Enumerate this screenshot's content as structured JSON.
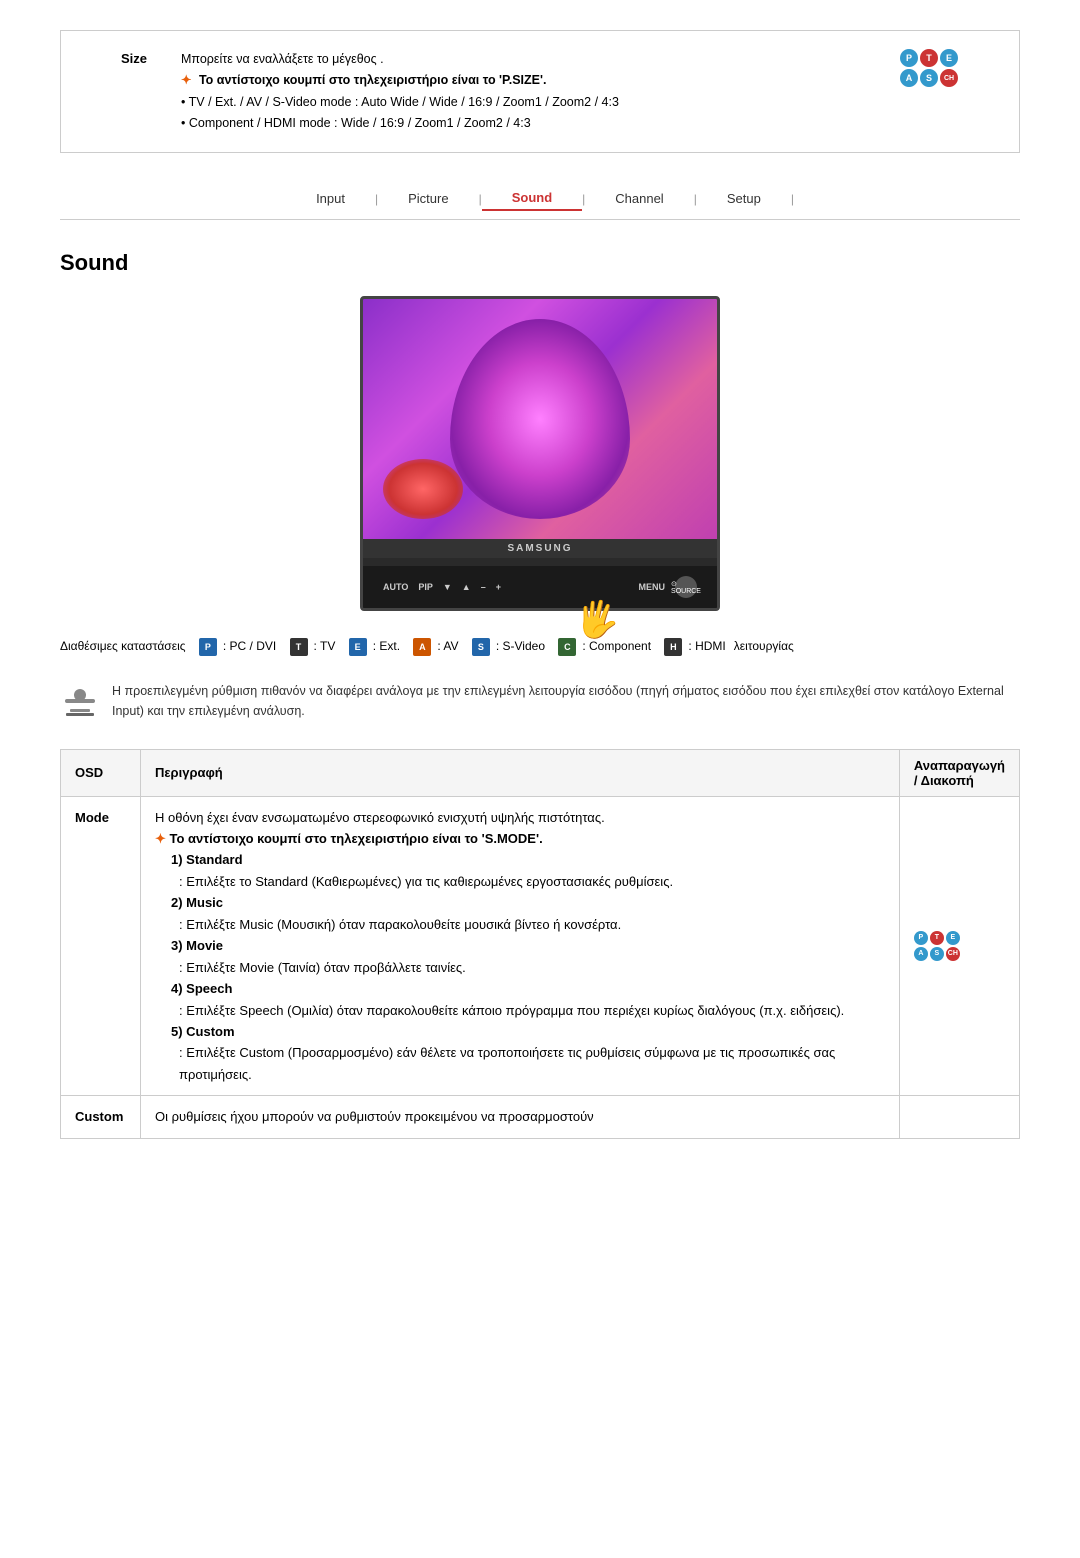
{
  "top": {
    "size_label": "Size",
    "size_text1": "Μπορείτε να εναλλάξετε το μέγεθος .",
    "size_text2": "Το αντίστοιχο κουμπί στο τηλεχειριστήριο είναι το 'P.SIZE'.",
    "size_text3": "TV / Ext. / AV / S-Video mode : Auto Wide / Wide / 16:9 / Zoom1 / Zoom2 / 4:3",
    "size_text4": "Component / HDMI mode : Wide / 16:9 / Zoom1 / Zoom2 / 4:3"
  },
  "nav": {
    "items": [
      {
        "label": "Input",
        "active": false
      },
      {
        "label": "Picture",
        "active": false
      },
      {
        "label": "Sound",
        "active": true
      },
      {
        "label": "Channel",
        "active": false
      },
      {
        "label": "Setup",
        "active": false
      }
    ]
  },
  "page": {
    "title": "Sound"
  },
  "tv": {
    "brand": "SAMSUNG",
    "buttons": [
      "AUTO",
      "PIP",
      "▼",
      "▲",
      "–",
      "+",
      "MENU",
      "SOURCE"
    ]
  },
  "modes_legend": {
    "label": "Διαθέσιμες καταστάσεις",
    "label2": "λειτουργίας",
    "modes": [
      {
        "letter": "P",
        "desc": "PC / DVI",
        "color": "blue"
      },
      {
        "letter": "T",
        "desc": "TV",
        "color": "dark"
      },
      {
        "letter": "E",
        "desc": "Ext.",
        "color": "blue"
      },
      {
        "letter": "A",
        "desc": "AV",
        "color": "orange"
      },
      {
        "letter": "S",
        "desc": "S-Video",
        "color": "blue"
      },
      {
        "letter": "C",
        "desc": "Component",
        "color": "green"
      },
      {
        "letter": "H",
        "desc": "HDMI",
        "color": "dark"
      }
    ]
  },
  "info_text": "Η προεπιλεγμένη ρύθμιση πιθανόν να διαφέρει ανάλογα με την επιλεγμένη λειτουργία εισόδου (πηγή σήματος εισόδου που έχει επιλεχθεί στον κατάλογο External Input) και την επιλεγμένη ανάλυση.",
  "table": {
    "headers": [
      "OSD",
      "Περιγραφή",
      "Αναπαραγωγή / Διακοπή"
    ],
    "rows": [
      {
        "osd": "Mode",
        "description_parts": [
          {
            "text": "Η οθόνη έχει έναν ενσωματωμένο στερεοφωνικό ενισχυτή υψηλής πιστότητας.",
            "type": "normal"
          },
          {
            "text": "Το αντίστοιχο κουμπί στο τηλεχειριστήριο είναι το 'S.MODE'.",
            "type": "arrow-bold"
          },
          {
            "text": "1) Standard",
            "type": "bold-indent"
          },
          {
            "text": ": Επιλέξτε το Standard (Καθιερωμένες) για τις καθιερωμένες εργοστασιακές ρυθμίσεις.",
            "type": "indent2"
          },
          {
            "text": "2) Music",
            "type": "bold-indent"
          },
          {
            "text": ": Επιλέξτε Music (Μουσική) όταν παρακολουθείτε μουσικά βίντεο ή κονσέρτα.",
            "type": "indent2"
          },
          {
            "text": "3) Movie",
            "type": "bold-indent"
          },
          {
            "text": ": Επιλέξτε Movie (Ταινία) όταν προβάλλετε ταινίες.",
            "type": "indent2"
          },
          {
            "text": "4) Speech",
            "type": "bold-indent"
          },
          {
            "text": ": Επιλέξτε Speech (Ομιλία) όταν παρακολουθείτε κάποιο πρόγραμμα που περιέχει κυρίως διαλόγους (π.χ. ειδήσεις).",
            "type": "indent2"
          },
          {
            "text": "5) Custom",
            "type": "bold-indent"
          },
          {
            "text": ": Επιλέξτε Custom (Προσαρμοσμένο) εάν θέλετε να τροποποιήσετε τις ρυθμίσεις σύμφωνα με τις προσωπικές σας προτιμήσεις.",
            "type": "indent2"
          }
        ],
        "icon": "pteas"
      },
      {
        "osd": "Custom",
        "description_parts": [
          {
            "text": "Οι ρυθμίσεις ήχου μπορούν να ρυθμιστούν προκειμένου να προσαρμοστούν",
            "type": "normal"
          }
        ],
        "icon": ""
      }
    ]
  }
}
